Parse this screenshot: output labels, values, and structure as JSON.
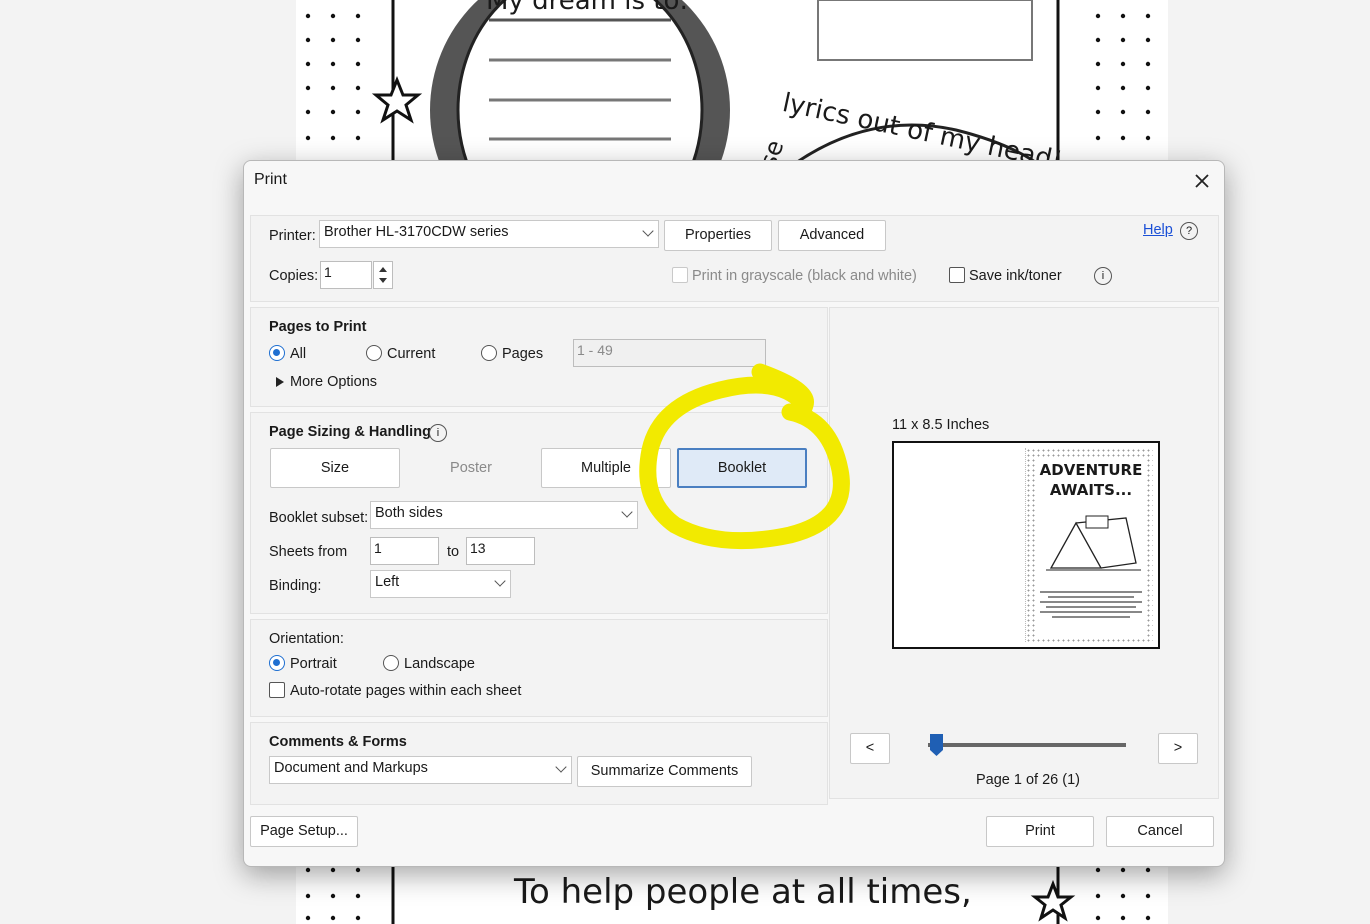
{
  "background": {
    "top_text": "My dream is to:",
    "top_right_text": "lyrics out of my head!",
    "top_right_partial": "se",
    "bottom_text": "To help people at all times,"
  },
  "dialog": {
    "title": "Print",
    "help_label": "Help",
    "printer": {
      "label": "Printer:",
      "value": "Brother HL-3170CDW series",
      "properties_label": "Properties",
      "advanced_label": "Advanced"
    },
    "copies": {
      "label": "Copies:",
      "value": "1"
    },
    "grayscale_label": "Print in grayscale (black and white)",
    "save_ink_label": "Save ink/toner",
    "pages_to_print": {
      "heading": "Pages to Print",
      "all_label": "All",
      "current_label": "Current",
      "pages_label": "Pages",
      "pages_value": "1 - 49",
      "more_options_label": "More Options"
    },
    "page_sizing": {
      "heading": "Page Sizing & Handling",
      "tabs": [
        "Size",
        "Poster",
        "Multiple",
        "Booklet"
      ],
      "selected_tab": "Booklet",
      "booklet_subset_label": "Booklet subset:",
      "booklet_subset_value": "Both sides",
      "sheets_from_label": "Sheets from",
      "sheets_from_value": "1",
      "to_label": "to",
      "sheets_to_value": "13",
      "binding_label": "Binding:",
      "binding_value": "Left"
    },
    "orientation": {
      "heading": "Orientation:",
      "portrait_label": "Portrait",
      "landscape_label": "Landscape",
      "auto_rotate_label": "Auto-rotate pages within each sheet"
    },
    "comments_forms": {
      "heading": "Comments & Forms",
      "value": "Document and Markups",
      "summarize_label": "Summarize Comments"
    },
    "preview": {
      "size_label": "11 x 8.5 Inches",
      "thumb_title_1": "ADVENTURE",
      "thumb_title_2": "AWAITS...",
      "prev_label": "<",
      "next_label": ">",
      "page_status": "Page 1 of 26 (1)",
      "slider_fraction": 0.04
    },
    "page_setup_label": "Page Setup...",
    "print_label": "Print",
    "cancel_label": "Cancel"
  },
  "colors": {
    "accent": "#1f6fd1",
    "highlight": "#f2ea00",
    "selected_tab_bg": "#dfeaf7"
  }
}
